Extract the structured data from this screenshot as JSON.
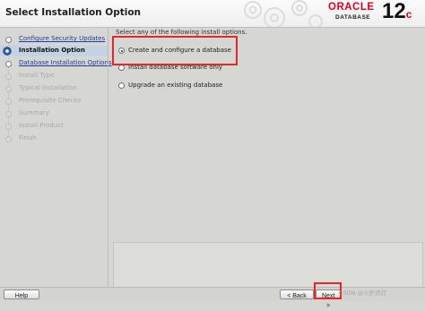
{
  "header": {
    "title": "Select Installation Option",
    "brand": {
      "oracle": "ORACLE",
      "product": "DATABASE",
      "version": "12",
      "version_suffix": "c"
    }
  },
  "steps": [
    {
      "label": "Configure Security Updates",
      "state": "done"
    },
    {
      "label": "Installation Option",
      "state": "active"
    },
    {
      "label": "Database Installation Options",
      "state": "done"
    },
    {
      "label": "Install Type",
      "state": "pending"
    },
    {
      "label": "Typical Installation",
      "state": "pending"
    },
    {
      "label": "Prerequisite Checks",
      "state": "pending"
    },
    {
      "label": "Summary",
      "state": "pending"
    },
    {
      "label": "Install Product",
      "state": "pending"
    },
    {
      "label": "Finish",
      "state": "pending"
    }
  ],
  "main": {
    "intro": "Select any of the following install options.",
    "options": [
      {
        "label": "Create and configure a database",
        "selected": true
      },
      {
        "label": "Install database software only",
        "selected": false
      },
      {
        "label": "Upgrade an existing database",
        "selected": false
      }
    ]
  },
  "footer": {
    "help": "Help",
    "back": "< Back",
    "next": "Next >"
  },
  "watermark": "CSDN @火炉点灯",
  "colors": {
    "highlight": "#e8262a",
    "oracle_red": "#e0001b",
    "active_step_bg": "#c4d2e6",
    "link": "#1e3aa0"
  }
}
